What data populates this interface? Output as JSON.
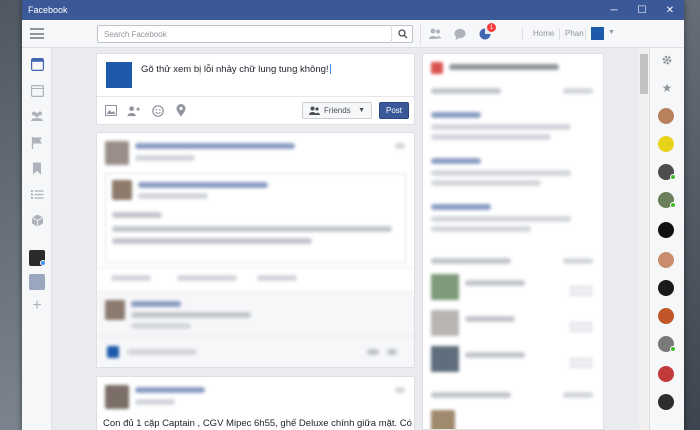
{
  "window": {
    "title": "Facebook",
    "controls": {
      "minimize": "─",
      "maximize": "☐",
      "close": "✕"
    }
  },
  "topnav": {
    "search_placeholder": "Search Facebook",
    "notification_count": "1",
    "home_label": "Home",
    "user_label": "Phan"
  },
  "composer": {
    "text": "Gõ thử xem bị lỗi nhảy chữ lung tung không!",
    "audience_label": "Friends",
    "post_label": "Post"
  },
  "feed": {
    "visible_text": "Con đủ 1 cặp Captain , CGV Mipec 6h55, ghế Deluxe chính giữa mặt. Có"
  },
  "colors": {
    "brand": "#3b5998",
    "badge": "#fa3e3e",
    "online": "#42b72a"
  },
  "icons": {
    "left_rail": [
      "news-feed-icon",
      "events-icon",
      "groups-icon",
      "pages-icon",
      "saved-icon",
      "lists-icon",
      "apps-icon"
    ],
    "chat_rail": [
      "settings-icon",
      "favorites-icon"
    ]
  }
}
